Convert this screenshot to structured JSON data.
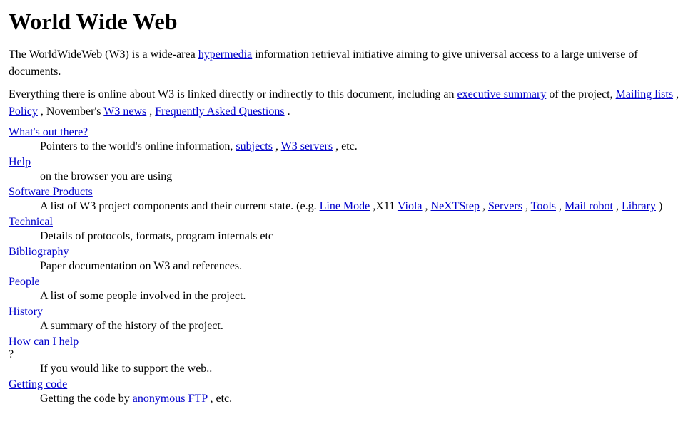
{
  "page": {
    "title": "World Wide Web",
    "intro1": "The WorldWideWeb (W3) is a wide-area hypermedia information retrieval initiative aiming to give universal access to a large universe of documents.",
    "intro1_link_text": "hypermedia",
    "intro2_prefix": "Everything there is online about W3 is linked directly or indirectly to this document, including an",
    "intro2_link1": "executive summary",
    "intro2_mid": "of the project,",
    "intro2_link2": "Mailing lists",
    "intro2_comma": ",",
    "intro2_link3": "Policy",
    "intro2_comma2": ", November's",
    "intro2_link4": "W3 news",
    "intro2_comma3": ",",
    "intro2_link5": "Frequently Asked Questions",
    "intro2_period": ".",
    "sections": [
      {
        "id": "whats-out-there",
        "link_text": "What's out there?",
        "description": "Pointers to the world's online information,",
        "desc_links": [
          "subjects",
          "W3 servers"
        ],
        "desc_suffix": ", etc."
      },
      {
        "id": "help",
        "link_text": "Help",
        "description": "on the browser you are using",
        "desc_links": []
      },
      {
        "id": "software-products",
        "link_text": "Software Products",
        "description_prefix": "A list of W3 project components and their current state. (e.g.",
        "desc_links": [
          "Line Mode",
          "X11",
          "Viola",
          "NeXTStep",
          "Servers",
          "Tools",
          "Mail robot",
          "Library"
        ],
        "desc_suffix": ")"
      },
      {
        "id": "technical",
        "link_text": "Technical",
        "description": "Details of protocols, formats, program internals etc",
        "desc_links": []
      },
      {
        "id": "bibliography",
        "link_text": "Bibliography",
        "description": "Paper documentation on W3 and references.",
        "desc_links": []
      },
      {
        "id": "people",
        "link_text": "People",
        "description": "A list of some people involved in the project.",
        "desc_links": []
      },
      {
        "id": "history",
        "link_text": "History",
        "description": "A summary of the history of the project.",
        "desc_links": []
      },
      {
        "id": "how-can-i-help",
        "link_text": "How can I help",
        "desc_suffix": "?",
        "description": "If you would like to support the web..",
        "desc_links": []
      },
      {
        "id": "getting-code",
        "link_text": "Getting code",
        "description_prefix": "Getting the code by",
        "desc_links": [
          "anonymous FTP"
        ],
        "desc_suffix": ", etc."
      }
    ]
  }
}
